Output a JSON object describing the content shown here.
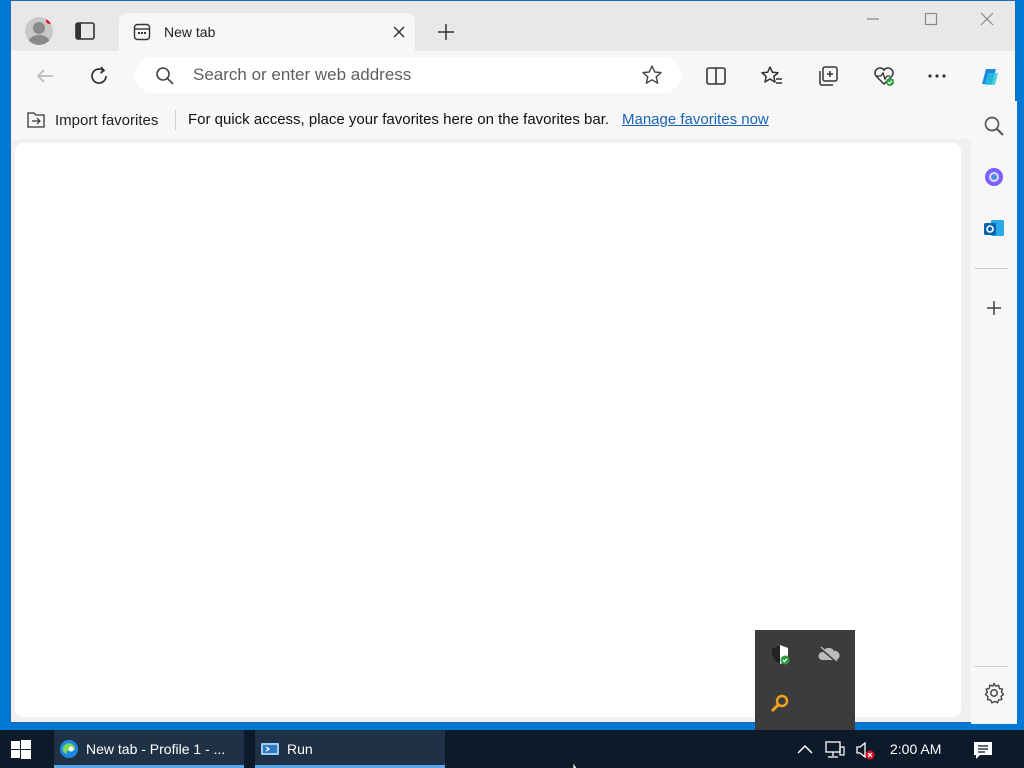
{
  "browser": {
    "tab": {
      "title": "New tab",
      "favicon": "new-tab-icon"
    },
    "address_bar": {
      "placeholder": "Search or enter web address"
    },
    "favorites_bar": {
      "import_label": "Import favorites",
      "message": "For quick access, place your favorites here on the favorites bar.",
      "manage_link": "Manage favorites now"
    },
    "toolbar_icons": [
      "back-icon",
      "refresh-icon",
      "split-screen-icon",
      "favorites-icon",
      "collections-icon",
      "browser-essentials-icon",
      "more-icon",
      "copilot-icon"
    ],
    "sidebar_icons": [
      "search-icon",
      "copilot-sidebar-icon",
      "outlook-icon",
      "add-icon",
      "settings-icon"
    ]
  },
  "taskbar": {
    "items": [
      {
        "label": "New tab - Profile 1 - ...",
        "icon": "edge-icon"
      },
      {
        "label": "Run",
        "icon": "run-icon"
      }
    ],
    "clock": "2:00 AM"
  },
  "colors": {
    "desktop": "#0078d4",
    "taskbar": "#0d1a2a",
    "link": "#1a64b8"
  }
}
